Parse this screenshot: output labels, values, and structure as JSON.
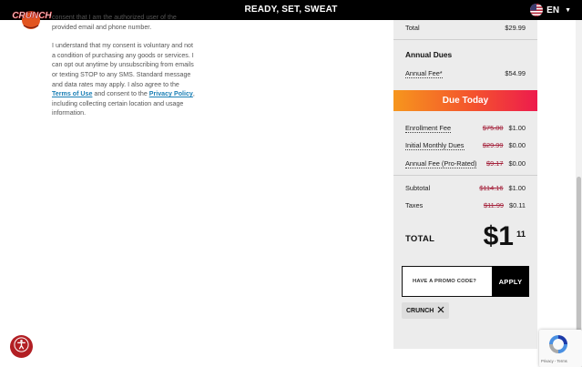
{
  "header": {
    "title": "READY, SET, SWEAT",
    "logo_text": "CRUNCH",
    "language": "EN"
  },
  "consent": {
    "p1": "consent that I am the authorized user of the provided email and phone number.",
    "p2_a": "I understand that my consent is voluntary and not a condition of purchasing any goods or services. I can opt out anytime by unsubscribing from emails or texting STOP to any SMS. Standard message and data rates may apply. I also agree to the ",
    "terms_link": "Terms of Use",
    "p2_b": " and consent to the ",
    "privacy_link": "Privacy Policy",
    "p2_c": ", including collecting certain location and usage information."
  },
  "summary": {
    "total_label": "Total",
    "total_value": "$29.99",
    "annual_dues_title": "Annual Dues",
    "annual_fee_label": "Annual Fee*",
    "annual_fee_value": "$54.99",
    "due_today_title": "Due Today",
    "enrollment_label": "Enrollment Fee",
    "enrollment_old": "$75.00",
    "enrollment_new": "$1.00",
    "monthly_label": "Initial Monthly Dues",
    "monthly_old": "$29.99",
    "monthly_new": "$0.00",
    "annual_pr_label": "Annual Fee (Pro-Rated)",
    "annual_pr_old": "$9.17",
    "annual_pr_new": "$0.00",
    "subtotal_label": "Subtotal",
    "subtotal_old": "$114.16",
    "subtotal_new": "$1.00",
    "taxes_label": "Taxes",
    "taxes_old": "$11.99",
    "taxes_new": "$0.11",
    "grand_total_label": "TOTAL",
    "grand_total_dollars": "$1",
    "grand_total_cents": "11",
    "promo_placeholder": "HAVE A PROMO CODE?",
    "apply_label": "APPLY",
    "applied_code": "CRUNCH"
  },
  "recaptcha": {
    "terms": "Privacy - Terms"
  },
  "colors": {
    "brand_red": "#b21f24",
    "strike": "#a4203a",
    "gradient_start": "#f6961d",
    "gradient_end": "#ed1b4d"
  }
}
